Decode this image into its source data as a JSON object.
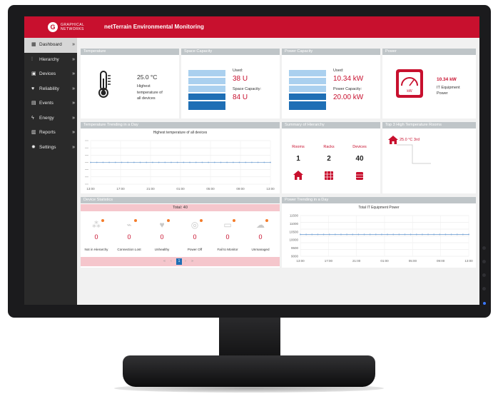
{
  "app": {
    "logo_mark": "G",
    "logo_text": "GRAPHICAL NETWORKS",
    "title": "netTerrain Environmental Monitoring"
  },
  "sidebar": {
    "items": [
      {
        "label": "Dashboard",
        "icon": "dashboard-icon",
        "active": true
      },
      {
        "label": "Hierarchy",
        "icon": "hierarchy-icon"
      },
      {
        "label": "Devices",
        "icon": "devices-icon"
      },
      {
        "label": "Reliability",
        "icon": "reliability-icon"
      },
      {
        "label": "Events",
        "icon": "events-icon"
      },
      {
        "label": "Energy",
        "icon": "energy-icon"
      },
      {
        "label": "Reports",
        "icon": "reports-icon"
      },
      {
        "label": "Settings",
        "icon": "settings-icon"
      }
    ],
    "chevron": "»"
  },
  "temperature": {
    "title": "Temperature",
    "value": "25.0 °C",
    "desc": [
      "Highest",
      "temperature of",
      "all devices"
    ]
  },
  "space": {
    "title": "Space Capacity",
    "used_label": "Used:",
    "used_value": "38 U",
    "cap_label": "Space Capacity:",
    "cap_value": "84 U",
    "fill_fraction": 0.45
  },
  "power_capacity": {
    "title": "Power Capacity",
    "used_label": "Used:",
    "used_value": "10.34 kW",
    "cap_label": "Power Capacity:",
    "cap_value": "20.00 kW",
    "fill_fraction": 0.52
  },
  "power": {
    "title": "Power",
    "value": "10.34 kW",
    "desc": [
      "IT Equipment",
      "Power"
    ],
    "gauge_label": "kW"
  },
  "temp_trend": {
    "title": "Temperature Trending in a Day",
    "chart_title": "Highest temperature of all devices",
    "x_ticks": [
      "13:00",
      "17:00",
      "21:00",
      "01:00",
      "05:00",
      "09:00",
      "13:00"
    ]
  },
  "hierarchy": {
    "title": "Summary of Hierarchy",
    "cols": [
      {
        "label": "Rooms",
        "value": "1",
        "icon": "room-icon"
      },
      {
        "label": "Racks",
        "value": "2",
        "icon": "rack-icon"
      },
      {
        "label": "Devices",
        "value": "40",
        "icon": "device-icon"
      }
    ]
  },
  "top_rooms": {
    "title": "Top 3 High Temperature Rooms",
    "entry": "25.0 °C 3rd"
  },
  "device_stats": {
    "title": "Device Statistics",
    "total": "Total: 40",
    "items": [
      {
        "label": "Not in Hierarchy",
        "value": "0",
        "icon": "hierarchy-off-icon"
      },
      {
        "label": "Connection Lost",
        "value": "0",
        "icon": "connection-lost-icon"
      },
      {
        "label": "Unhealthy",
        "value": "0",
        "icon": "unhealthy-icon"
      },
      {
        "label": "Power Off",
        "value": "0",
        "icon": "power-off-icon"
      },
      {
        "label": "Fail to Monitor",
        "value": "0",
        "icon": "fail-monitor-icon"
      },
      {
        "label": "Unmanaged",
        "value": "0",
        "icon": "unmanaged-icon"
      }
    ],
    "pagination": {
      "first": "«",
      "prev": "‹",
      "current": "1",
      "next": "›",
      "last": "»"
    }
  },
  "power_trend": {
    "title": "Power Trending in a Day",
    "chart_title": "Total IT Equipment Power",
    "y_ticks": [
      "11500",
      "11000",
      "10500",
      "10000",
      "9500",
      "9000"
    ],
    "x_ticks": [
      "13:00",
      "17:00",
      "21:00",
      "01:00",
      "05:00",
      "09:00",
      "13:00"
    ]
  },
  "chart_data": [
    {
      "type": "line",
      "title": "Highest temperature of all devices",
      "x": [
        "13:00",
        "17:00",
        "21:00",
        "01:00",
        "05:00",
        "09:00",
        "13:00"
      ],
      "series": [
        {
          "values": [
            25,
            25,
            25,
            25,
            25,
            25,
            25
          ]
        }
      ],
      "ylim": [
        0,
        50
      ],
      "grid": true,
      "color": "#7aa6d6"
    },
    {
      "type": "line",
      "title": "Total IT Equipment Power",
      "x": [
        "13:00",
        "17:00",
        "21:00",
        "01:00",
        "05:00",
        "09:00",
        "13:00"
      ],
      "series": [
        {
          "values": [
            10340,
            10340,
            10340,
            10340,
            10340,
            10340,
            10340
          ]
        }
      ],
      "ylim": [
        9000,
        11500
      ],
      "grid": true,
      "color": "#7aa6d6"
    }
  ]
}
